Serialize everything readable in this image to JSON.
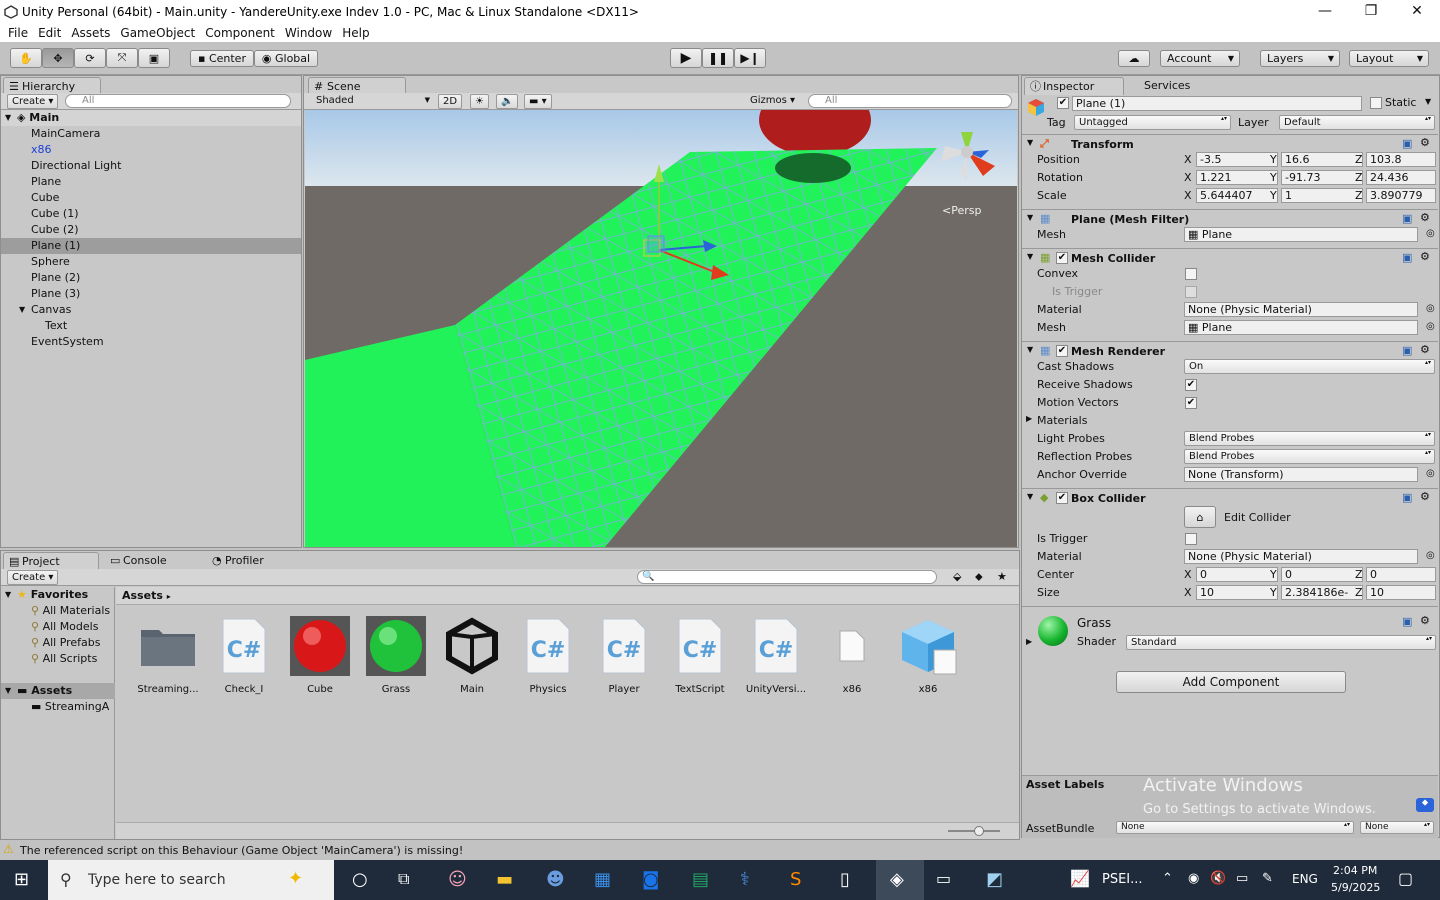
{
  "window": {
    "title": "Unity Personal (64bit) - Main.unity - YandereUnity.exe Indev 1.0 - PC, Mac & Linux Standalone <DX11>",
    "minimize": "—",
    "maximize": "❐",
    "close": "✕"
  },
  "menu": [
    "File",
    "Edit",
    "Assets",
    "GameObject",
    "Component",
    "Window",
    "Help"
  ],
  "toolbar": {
    "pivot": "Center",
    "space": "Global",
    "account": "Account",
    "layers": "Layers",
    "layout": "Layout"
  },
  "hierarchy": {
    "tab": "Hierarchy",
    "create": "Create",
    "search_placeholder": "All",
    "scene": "Main",
    "items": [
      {
        "label": "MainCamera",
        "indent": 1,
        "color": "#111"
      },
      {
        "label": "x86",
        "indent": 1,
        "color": "#1a3fd6"
      },
      {
        "label": "Directional Light",
        "indent": 1,
        "color": "#111"
      },
      {
        "label": "Plane",
        "indent": 1,
        "color": "#111"
      },
      {
        "label": "Cube",
        "indent": 1,
        "color": "#111"
      },
      {
        "label": "Cube (1)",
        "indent": 1,
        "color": "#111"
      },
      {
        "label": "Cube (2)",
        "indent": 1,
        "color": "#111"
      },
      {
        "label": "Plane (1)",
        "indent": 1,
        "color": "#111",
        "selected": true
      },
      {
        "label": "Sphere",
        "indent": 1,
        "color": "#111"
      },
      {
        "label": "Plane (2)",
        "indent": 1,
        "color": "#111"
      },
      {
        "label": "Plane (3)",
        "indent": 1,
        "color": "#111"
      },
      {
        "label": "Canvas",
        "indent": 1,
        "color": "#111",
        "expanded": true
      },
      {
        "label": "Text",
        "indent": 2,
        "color": "#111"
      },
      {
        "label": "EventSystem",
        "indent": 1,
        "color": "#111"
      }
    ]
  },
  "scene": {
    "tab": "Scene",
    "shading": "Shaded",
    "mode2d": "2D",
    "gizmos": "Gizmos",
    "search_placeholder": "All",
    "persp": "Persp"
  },
  "inspector": {
    "tab": "Inspector",
    "tab2": "Services",
    "object_name": "Plane (1)",
    "static_label": "Static",
    "tag_label": "Tag",
    "tag": "Untagged",
    "layer_label": "Layer",
    "layer": "Default",
    "transform": {
      "title": "Transform",
      "position_label": "Position",
      "rotation_label": "Rotation",
      "scale_label": "Scale",
      "position": {
        "x": "-3.5",
        "y": "16.6",
        "z": "103.8"
      },
      "rotation": {
        "x": "1.221",
        "y": "-91.73",
        "z": "24.436"
      },
      "scale": {
        "x": "5.644407",
        "y": "1",
        "z": "3.890779"
      }
    },
    "mesh_filter": {
      "title": "Plane (Mesh Filter)",
      "mesh_label": "Mesh",
      "mesh": "Plane"
    },
    "mesh_collider": {
      "title": "Mesh Collider",
      "convex_label": "Convex",
      "trigger_label": "Is Trigger",
      "material_label": "Material",
      "material": "None (Physic Material)",
      "mesh_label": "Mesh",
      "mesh": "Plane"
    },
    "mesh_renderer": {
      "title": "Mesh Renderer",
      "cast_label": "Cast Shadows",
      "cast": "On",
      "receive_label": "Receive Shadows",
      "motion_label": "Motion Vectors",
      "materials_label": "Materials",
      "light_label": "Light Probes",
      "light": "Blend Probes",
      "reflection_label": "Reflection Probes",
      "reflection": "Blend Probes",
      "anchor_label": "Anchor Override",
      "anchor": "None (Transform)"
    },
    "box_collider": {
      "title": "Box Collider",
      "edit": "Edit Collider",
      "trigger_label": "Is Trigger",
      "material_label": "Material",
      "material": "None (Physic Material)",
      "center_label": "Center",
      "size_label": "Size",
      "center": {
        "x": "0",
        "y": "0",
        "z": "0"
      },
      "size": {
        "x": "10",
        "y": "2.384186e-",
        "z": "10"
      }
    },
    "material": {
      "name": "Grass",
      "shader_label": "Shader",
      "shader": "Standard"
    },
    "add_component": "Add Component",
    "asset_labels": "Asset Labels",
    "asset_bundle": "AssetBundle",
    "bundle_value": "None",
    "variant_value": "None",
    "activate_title": "Activate Windows",
    "activate_sub": "Go to Settings to activate Windows."
  },
  "project": {
    "tab": "Project",
    "tab2": "Console",
    "tab3": "Profiler",
    "create": "Create",
    "favorites": "Favorites",
    "fav_items": [
      "All Materials",
      "All Models",
      "All Prefabs",
      "All Scripts"
    ],
    "assets_root": "Assets",
    "assets_child": "StreamingA",
    "breadcrumb": "Assets",
    "assets": [
      {
        "label": "Streaming...",
        "kind": "folder"
      },
      {
        "label": "Check_I",
        "kind": "script"
      },
      {
        "label": "Cube",
        "kind": "red"
      },
      {
        "label": "Grass",
        "kind": "green"
      },
      {
        "label": "Main",
        "kind": "unity"
      },
      {
        "label": "Physics",
        "kind": "script"
      },
      {
        "label": "Player",
        "kind": "script"
      },
      {
        "label": "TextScript",
        "kind": "script"
      },
      {
        "label": "UnityVersi...",
        "kind": "script"
      },
      {
        "label": "x86",
        "kind": "file"
      },
      {
        "label": "x86",
        "kind": "cube"
      }
    ]
  },
  "status": {
    "message": "The referenced script on this Behaviour (Game Object 'MainCamera') is missing!"
  },
  "taskbar": {
    "search_placeholder": "Type here to search",
    "stock": "PSEI...",
    "lang": "ENG",
    "time": "2:04 PM",
    "date": "5/9/2025"
  }
}
